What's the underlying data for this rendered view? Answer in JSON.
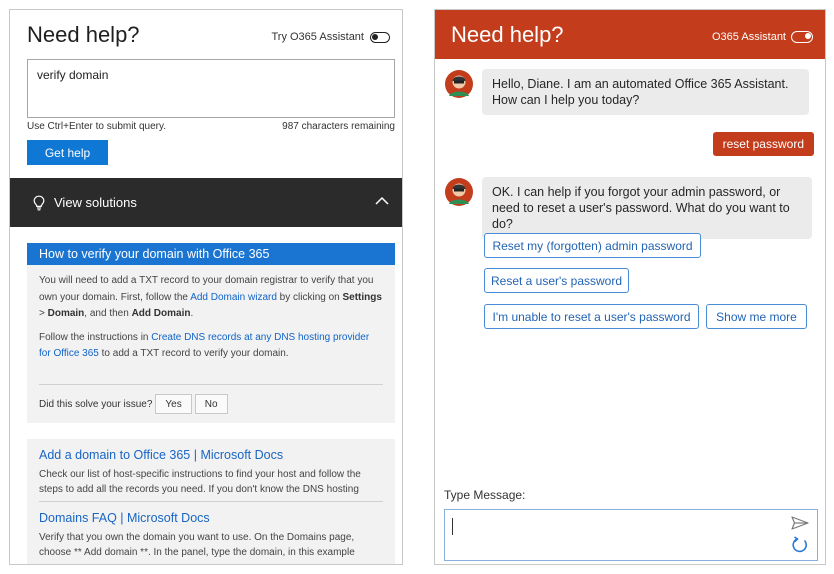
{
  "left_panel": {
    "title": "Need help?",
    "assistant_toggle_label": "Try O365 Assistant",
    "query_value": "verify domain",
    "submit_hint": "Use Ctrl+Enter to submit query.",
    "chars_remaining": "987 characters remaining",
    "get_help_label": "Get help",
    "solutions_label": "View solutions",
    "result": {
      "title": "How to verify your domain with Office 365",
      "p1_a": "You will need to add a TXT record to your domain registrar to verify that you own your domain. First, follow the ",
      "p1_link": "Add Domain wizard",
      "p1_b": " by clicking on ",
      "p1_bold1": "Settings",
      "p1_c": " > ",
      "p1_bold2": "Domain",
      "p1_d": ", and then ",
      "p1_bold3": "Add Domain",
      "p1_e": ".",
      "p2_a": "Follow the instructions in ",
      "p2_link": "Create DNS records at any DNS hosting provider for Office 365",
      "p2_b": " to add a TXT record to verify your domain.",
      "solve_question": "Did this solve your issue?",
      "yes_label": "Yes",
      "no_label": "No"
    },
    "docs": [
      {
        "title": "Add a domain to Office 365 | Microsoft Docs",
        "text": "Check our list of host-specific instructions to find your host and follow the steps to add all the records you need. If you don't know the DNS hosting"
      },
      {
        "title": "Domains FAQ | Microsoft Docs",
        "text": "Verify that you own the domain you want to use. On the Domains page, choose ** Add domain **. In the panel, type the domain, in this example"
      }
    ]
  },
  "right_panel": {
    "title": "Need help?",
    "assistant_toggle_label": "O365 Assistant",
    "messages": {
      "bot1": "Hello, Diane. I am an automated Office 365 Assistant. How can I help you today?",
      "user1": "reset password",
      "bot2": "OK. I can help if you forgot your admin password, or need to reset a user's password. What do you want to do?"
    },
    "options": [
      "Reset my (forgotten) admin password",
      "Reset a user's password",
      "I'm unable to reset a user's password",
      "Show me more"
    ],
    "type_message_label": "Type Message:"
  },
  "colors": {
    "brand_red": "#c33c1b",
    "accent_blue": "#0f78d4",
    "dark_bar": "#2b2b2b"
  },
  "icons": [
    "toggle-icon",
    "lightbulb-icon",
    "chevron-up-icon",
    "bot-avatar-icon",
    "send-icon",
    "refresh-icon"
  ]
}
